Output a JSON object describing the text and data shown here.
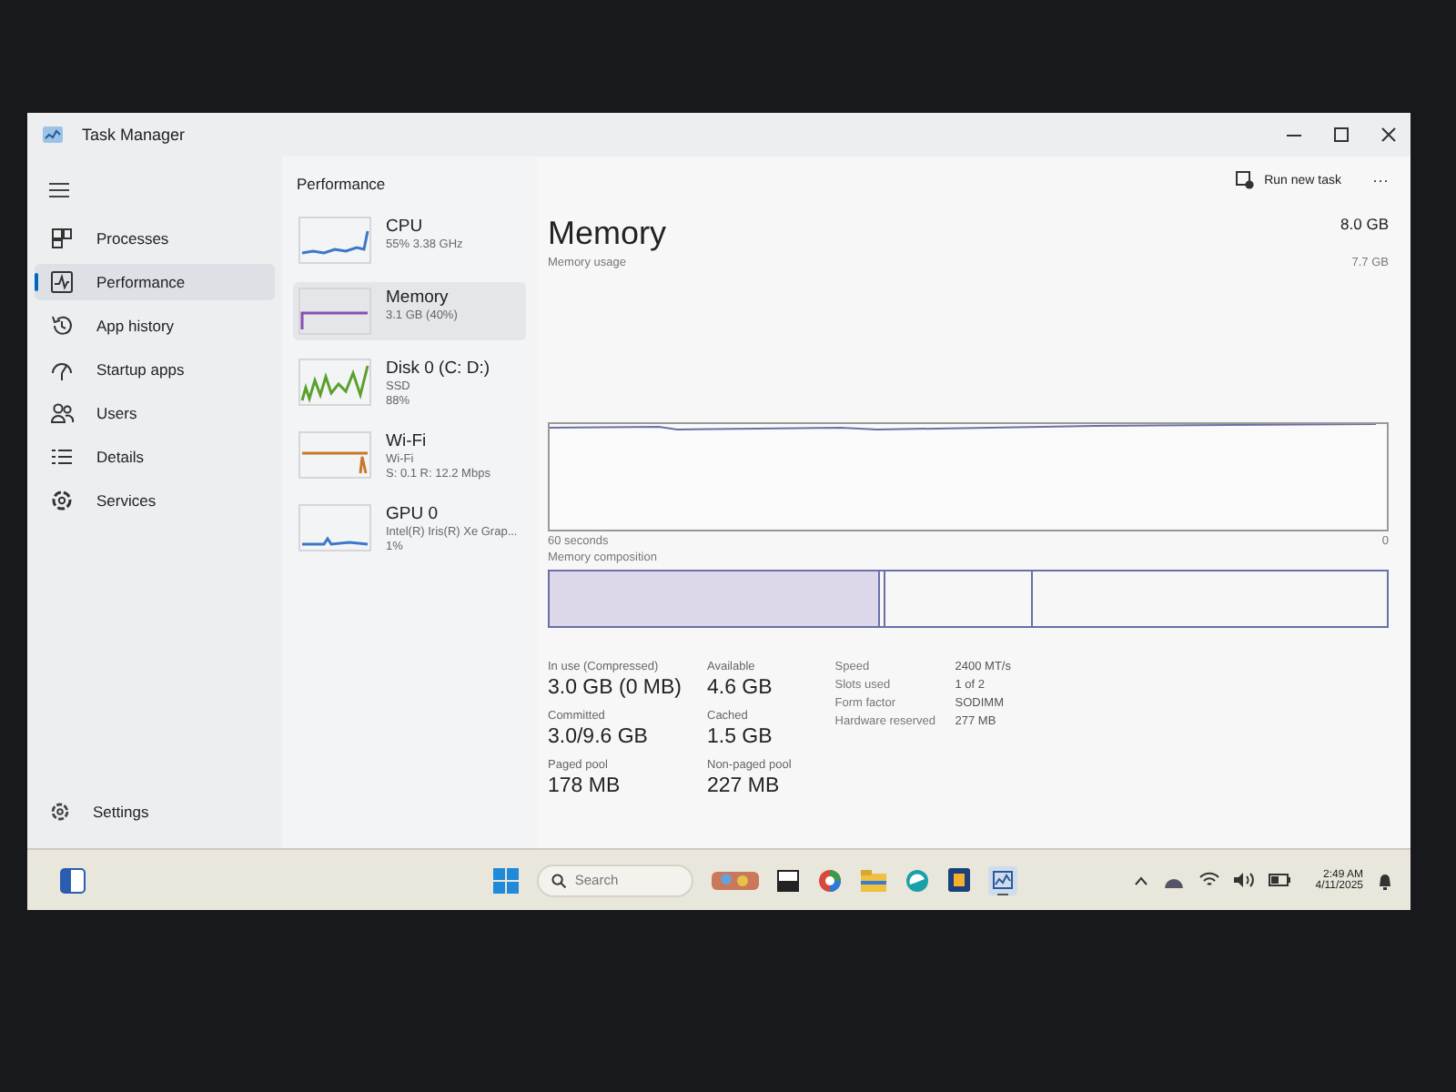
{
  "window": {
    "title": "Task Manager"
  },
  "toolbar": {
    "run_new_task": "Run new task",
    "more": "···"
  },
  "sidebar": {
    "items": [
      {
        "label": "Processes",
        "kind": "processes",
        "selected": false
      },
      {
        "label": "Performance",
        "kind": "performance",
        "selected": true
      },
      {
        "label": "App history",
        "kind": "history",
        "selected": false
      },
      {
        "label": "Startup apps",
        "kind": "startup",
        "selected": false
      },
      {
        "label": "Users",
        "kind": "users",
        "selected": false
      },
      {
        "label": "Details",
        "kind": "details",
        "selected": false
      },
      {
        "label": "Services",
        "kind": "services",
        "selected": false
      }
    ],
    "settings": "Settings"
  },
  "performance": {
    "title": "Performance",
    "items": [
      {
        "name": "CPU",
        "lines": [
          "55% 3.38 GHz"
        ],
        "color": "#3c78c8",
        "selected": false
      },
      {
        "name": "Memory",
        "lines": [
          "3.1 GB (40%)"
        ],
        "color": "#8a4fb0",
        "selected": true
      },
      {
        "name": "Disk 0 (C: D:)",
        "lines": [
          "SSD",
          "88%"
        ],
        "color": "#5aa02c",
        "selected": false
      },
      {
        "name": "Wi-Fi",
        "lines": [
          "Wi-Fi",
          "S: 0.1 R: 12.2 Mbps"
        ],
        "color": "#c8782c",
        "selected": false
      },
      {
        "name": "GPU 0",
        "lines": [
          "Intel(R) Iris(R) Xe Grap...",
          "1%"
        ],
        "color": "#3c78c8",
        "selected": false
      }
    ]
  },
  "memory": {
    "title": "Memory",
    "total": "8.0 GB",
    "subtitle": "Memory usage",
    "max": "7.7 GB",
    "time_span": "60 seconds",
    "min": "0",
    "composition_label": "Memory composition",
    "stats": [
      {
        "label": "In use (Compressed)",
        "value": "3.0 GB (0 MB)"
      },
      {
        "label": "Available",
        "value": "4.6 GB"
      },
      {
        "label": "Committed",
        "value": "3.0/9.6 GB"
      },
      {
        "label": "Cached",
        "value": "1.5 GB"
      },
      {
        "label": "Paged pool",
        "value": "178 MB"
      },
      {
        "label": "Non-paged pool",
        "value": "227 MB"
      }
    ],
    "specs": [
      {
        "label": "Speed",
        "value": "2400 MT/s"
      },
      {
        "label": "Slots used",
        "value": "1 of 2"
      },
      {
        "label": "Form factor",
        "value": "SODIMM"
      },
      {
        "label": "Hardware reserved",
        "value": "277 MB"
      }
    ]
  },
  "taskbar": {
    "search": {
      "placeholder": "Search"
    },
    "time": "2:49 AM",
    "date": "4/11/2025"
  }
}
